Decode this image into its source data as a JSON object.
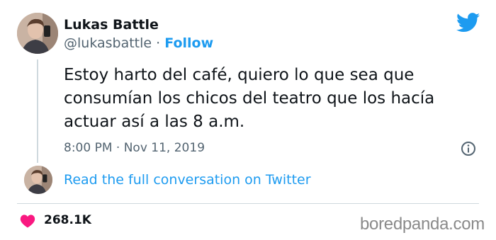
{
  "author": {
    "name": "Lukas Battle",
    "handle": "@lukasbattle",
    "separator": "·",
    "follow_label": "Follow"
  },
  "tweet": {
    "text": "Estoy harto del café, quiero lo que sea que consumían los chicos del teatro que los hacía actuar así a las 8 a.m.",
    "time": "8:00 PM",
    "date_separator": "·",
    "date": "Nov 11, 2019"
  },
  "conversation_link": "Read the full conversation on Twitter",
  "likes": "268.1K",
  "watermark": "boredpanda.com",
  "icons": {
    "brand": "twitter-bird-icon",
    "info": "info-icon",
    "like": "heart-icon"
  },
  "colors": {
    "link": "#1d9bf0",
    "secondary_text": "#536471",
    "heart": "#f91880",
    "twitter_brand": "#1d9bf0"
  }
}
